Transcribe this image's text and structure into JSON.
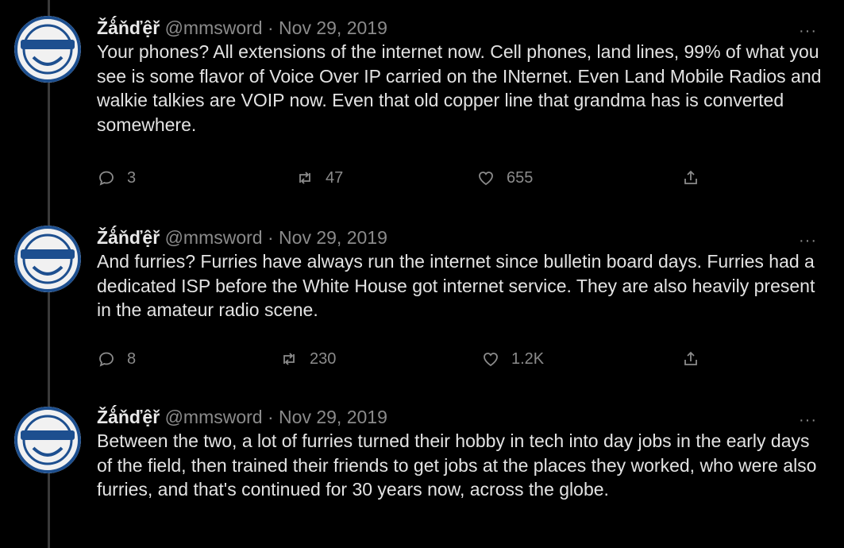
{
  "tweets": [
    {
      "display_name": "Žǻňďệř",
      "handle": "@mmsword",
      "separator": "·",
      "date": "Nov 29, 2019",
      "more": "···",
      "text": "Your phones? All extensions of the internet now. Cell phones, land lines, 99% of what you see is some flavor of Voice Over IP carried on the INternet. Even Land Mobile Radios and walkie talkies are VOIP now.  Even that old copper line that grandma has is converted somewhere.",
      "replies": "3",
      "retweets": "47",
      "likes": "655"
    },
    {
      "display_name": "Žǻňďệř",
      "handle": "@mmsword",
      "separator": "·",
      "date": "Nov 29, 2019",
      "more": "···",
      "text": "And furries? Furries have always run the internet since bulletin board days. Furries had a dedicated ISP before the White House got internet service. They are also heavily present in the amateur radio scene.",
      "replies": "8",
      "retweets": "230",
      "likes": "1.2K"
    },
    {
      "display_name": "Žǻňďệř",
      "handle": "@mmsword",
      "separator": "·",
      "date": "Nov 29, 2019",
      "more": "···",
      "text": "Between the two, a lot of furries turned their hobby in tech into day jobs in the early days of the field, then trained their friends to get jobs at the places they worked, who were also furries, and that's continued for 30 years now, across the globe."
    }
  ],
  "icons": {
    "reply": "reply-icon",
    "retweet": "retweet-icon",
    "like": "heart-icon",
    "share": "share-icon",
    "avatar": "laughing-man-avatar"
  },
  "colors": {
    "background": "#000000",
    "text": "#e3e3e3",
    "muted": "#8b8b8b",
    "thread_line": "#3a3a3a"
  }
}
